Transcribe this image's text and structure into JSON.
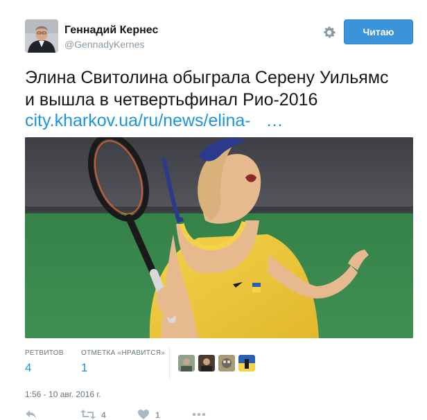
{
  "author": {
    "display_name": "Геннадий Кернес",
    "handle": "@GennadyKernes"
  },
  "follow_button": {
    "label": "Читаю"
  },
  "icons": {
    "settings": "gear-icon",
    "reply": "reply-icon",
    "retweet": "retweet-icon",
    "like": "heart-icon",
    "more": "more-icon"
  },
  "tweet": {
    "text_lines": [
      "Элина Свитолина обыграла Серену Уильямс",
      "и вышла в четвертьфинал Рио-2016"
    ],
    "link_text": "city.kharkov.ua/ru/news/elina-",
    "link_ellipsis": "…"
  },
  "stats": {
    "retweets_label": "РЕТВИТОВ",
    "retweets_count": "4",
    "likes_label": "ОТМЕТКА «НРАВИТСЯ»",
    "likes_count": "1"
  },
  "timestamp": "1:56 - 10 авг. 2016 г.",
  "actions": {
    "retweet_count": "4",
    "like_count": "1"
  },
  "colors": {
    "accent": "#1b95e0",
    "follow_button": "#3b94d9",
    "secondary_text": "#66757f",
    "court_green": "#2f7a44"
  }
}
